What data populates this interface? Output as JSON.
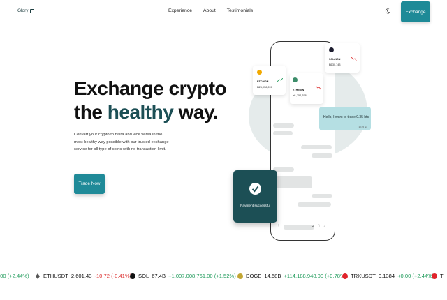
{
  "nav": {
    "logo": "Glory",
    "links": [
      "Experience",
      "About",
      "Testimonials"
    ],
    "cta": "Exchange"
  },
  "hero": {
    "title_line1": "Exchange crypto",
    "title_pre": "the ",
    "title_accent": "healthy",
    "title_post": " way.",
    "description": "Convert your crypto to naira and vice versa in the most healthy way possible with our trusted exchange service for all type of coins with no transaction limit.",
    "button": "Trade Now"
  },
  "cards": [
    {
      "name": "BTC/NGN",
      "value": "₦25,058,228",
      "color": "#f2a900",
      "trend": "up"
    },
    {
      "name": "ETH/NGN",
      "value": "₦1,752,798",
      "color": "#3c8d6a",
      "trend": "down"
    },
    {
      "name": "SOL/NGN",
      "value": "₦130,743",
      "color": "#1c1c2e",
      "trend": "down"
    }
  ],
  "chat": {
    "message": "Hello, I want to trade 0.35 btc.",
    "time": "10:45 pm"
  },
  "payment": {
    "text": "Payment successful"
  },
  "colors": {
    "accent": "#1e8a97",
    "dark_teal": "#1c4f55",
    "positive": "#1e9a5a",
    "negative": "#dd3333"
  },
  "ticker": [
    {
      "symbol": "",
      "price": "",
      "change": ".00 (+2.44%)",
      "dir": "pos",
      "icon": "none"
    },
    {
      "symbol": "ETHUSDT",
      "price": "2,601.43",
      "change": "-10.72 (-0.41%)",
      "dir": "neg",
      "icon": "eth-icon"
    },
    {
      "symbol": "SOL",
      "price": "67.4B",
      "change": "+1,007,008,761.00 (+1.52%)",
      "dir": "pos",
      "icon": "sol-icon"
    },
    {
      "symbol": "DOGE",
      "price": "14.68B",
      "change": "+114,188,948.00 (+0.78%)",
      "dir": "pos",
      "icon": "doge-icon"
    },
    {
      "symbol": "TRXUSDT",
      "price": "0.1384",
      "change": "+0.00 (+2.44%)",
      "dir": "pos",
      "icon": "trx-icon"
    },
    {
      "symbol": "T",
      "price": "",
      "change": "",
      "dir": "pos",
      "icon": "trx-icon"
    }
  ]
}
